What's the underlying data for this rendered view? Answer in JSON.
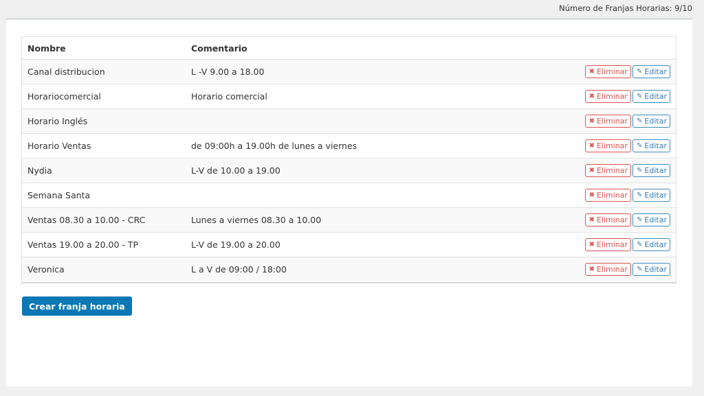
{
  "header": {
    "counter_text": "Número de Franjas Horarias: 9/10"
  },
  "table": {
    "columns": [
      "Nombre",
      "Comentario"
    ],
    "rows": [
      {
        "name": "Canal distribucion",
        "comment": "L -V 9.00 a 18.00"
      },
      {
        "name": "Horariocomercial",
        "comment": "Horario comercial"
      },
      {
        "name": "Horario Inglés",
        "comment": ""
      },
      {
        "name": "Horario Ventas",
        "comment": "de 09:00h a 19.00h de lunes a viernes"
      },
      {
        "name": "Nydia",
        "comment": "L-V de 10.00 a 19.00"
      },
      {
        "name": "Semana Santa",
        "comment": ""
      },
      {
        "name": "Ventas 08.30 a 10.00 - CRC",
        "comment": "Lunes a viernes 08.30 a 10.00"
      },
      {
        "name": "Ventas 19.00 a 20.00 - TP",
        "comment": "L-V de 19.00 a 20.00"
      },
      {
        "name": "Veronica",
        "comment": "L a V de 09:00 / 18:00"
      }
    ],
    "delete_label": "Eliminar",
    "edit_label": "Editar",
    "delete_icon": "times-icon",
    "edit_icon": "pencil-icon"
  },
  "actions": {
    "create_label": "Crear franja horaria"
  },
  "colors": {
    "primary": "#0a78b4",
    "danger": "#d9534f",
    "info": "#337ab7"
  }
}
